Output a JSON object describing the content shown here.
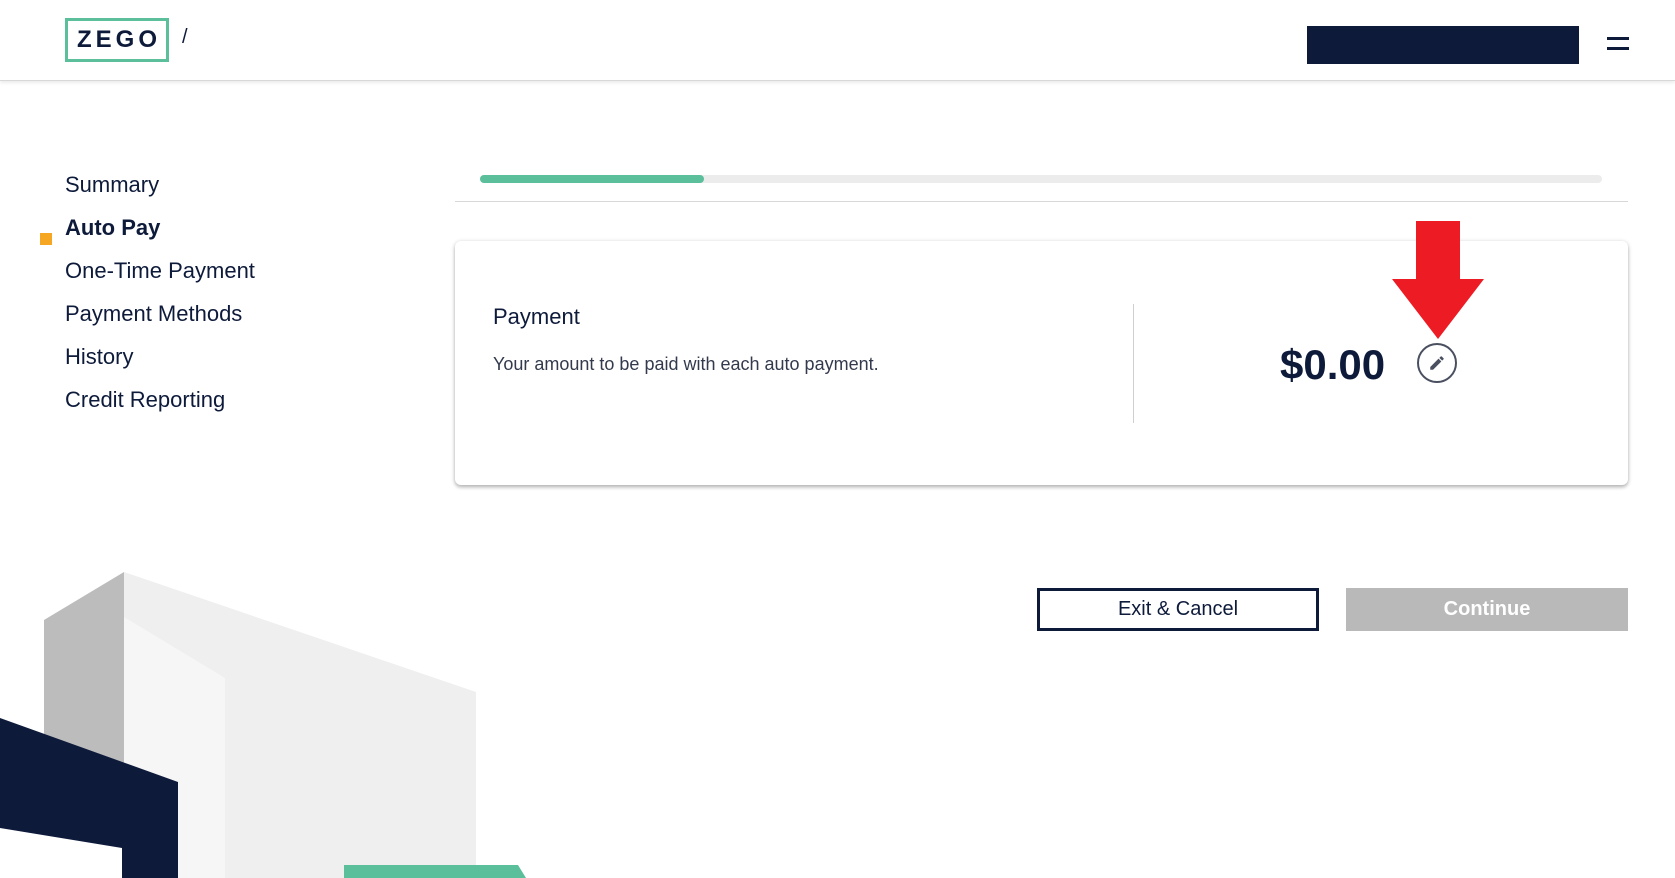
{
  "header": {
    "logo_text": "ZEGO",
    "breadcrumb_separator": "/",
    "menu_icon": "hamburger-menu-icon"
  },
  "sidebar": {
    "items": [
      {
        "label": "Summary",
        "active": false
      },
      {
        "label": "Auto Pay",
        "active": true
      },
      {
        "label": "One-Time Payment",
        "active": false
      },
      {
        "label": "Payment Methods",
        "active": false
      },
      {
        "label": "History",
        "active": false
      },
      {
        "label": "Credit Reporting",
        "active": false
      }
    ]
  },
  "progress": {
    "fraction": 0.2
  },
  "payment_card": {
    "title": "Payment",
    "description": "Your amount to be paid with each auto payment.",
    "amount": "$0.00",
    "edit_icon": "pencil-icon"
  },
  "actions": {
    "exit_label": "Exit & Cancel",
    "continue_label": "Continue"
  },
  "colors": {
    "brand_navy": "#0d1a3a",
    "brand_green": "#5bbf9c",
    "active_marker": "#f5a623",
    "disabled_button": "#b9b9b9",
    "annotation_red": "#ed1c24"
  }
}
